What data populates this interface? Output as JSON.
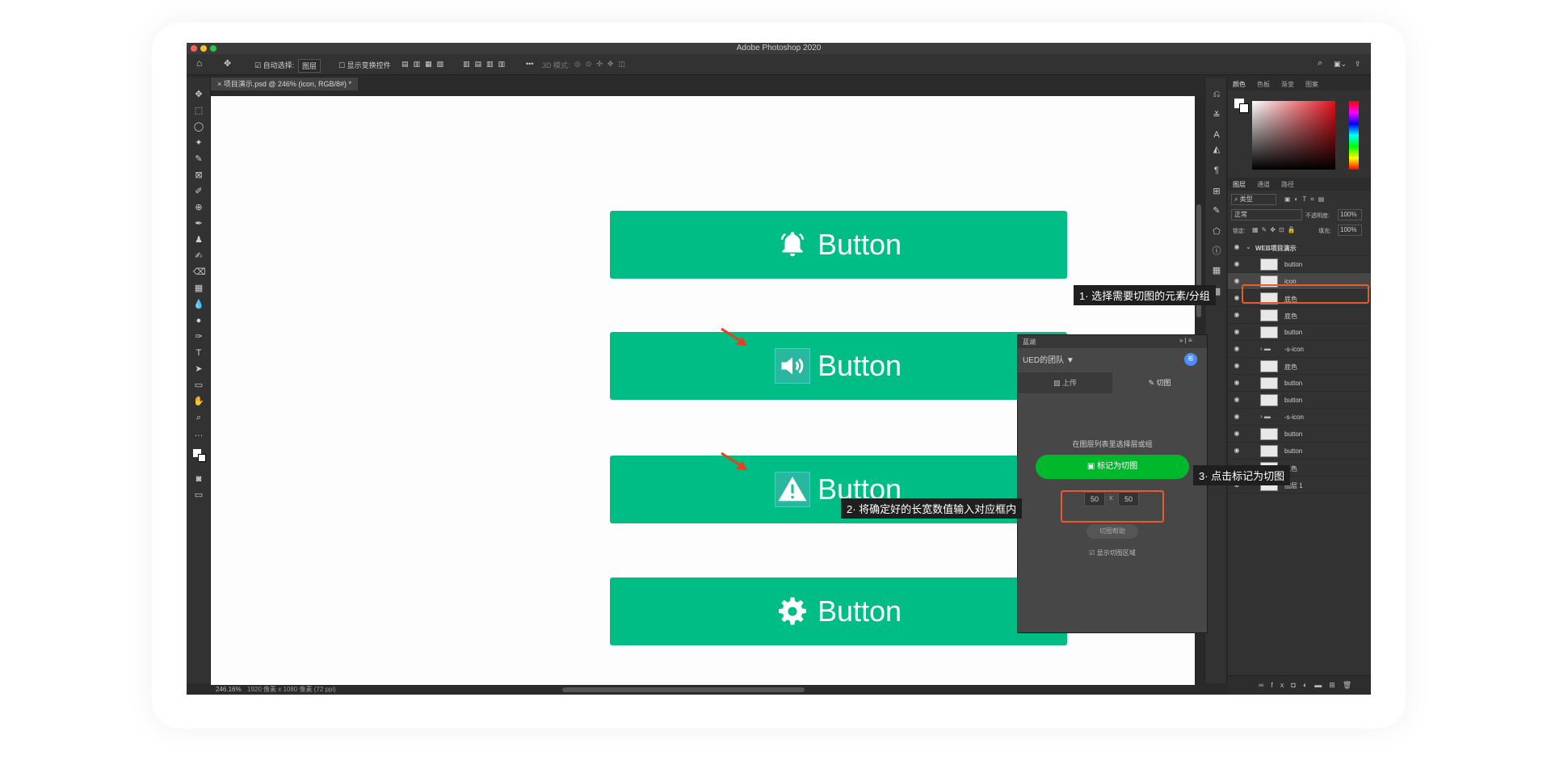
{
  "app": {
    "title": "Adobe Photoshop 2020"
  },
  "options_bar": {
    "auto_select_label": "自动选择:",
    "auto_select_value": "图层",
    "show_transform_label": "显示变换控件",
    "mode_3d_label": "3D 模式:"
  },
  "document": {
    "tab_title": "项目演示.psd @ 246% (icon, RGB/8#) *",
    "zoom": "246.16%",
    "info": "1920 像素 x 1080 像素 (72 ppi)"
  },
  "canvas": {
    "buttons": [
      {
        "label": "Button",
        "icon": "bell-icon"
      },
      {
        "label": "Button",
        "icon": "speaker-icon"
      },
      {
        "label": "Button",
        "icon": "warning-icon"
      },
      {
        "label": "Button",
        "icon": "gear-icon"
      }
    ],
    "accent": "#00bd86"
  },
  "color_panel": {
    "tabs": [
      "颜色",
      "色板",
      "渐变",
      "图案"
    ]
  },
  "layers_panel": {
    "tabs": [
      "图层",
      "通道",
      "路径"
    ],
    "filter_label": "类型",
    "blend_mode": "正常",
    "opacity_label": "不透明度:",
    "opacity_value": "100%",
    "lock_label": "锁定:",
    "fill_label": "填充:",
    "fill_value": "100%",
    "group_name": "WEB项目演示",
    "layers": [
      "button",
      "icon",
      "底色",
      "底色",
      "button",
      "-s-icon",
      "底色",
      "button",
      "button",
      "-s-icon",
      "button",
      "button",
      "底色",
      "图层 1"
    ]
  },
  "plugin": {
    "title": "蓝湖",
    "team": "UED的团队",
    "avatar": "彬",
    "tab_upload": "上传",
    "tab_slice": "切图",
    "hint": "在图层列表里选择层或组",
    "mark_button": "标记为切图",
    "width_value": "50",
    "height_value": "50",
    "times": "x",
    "help_button": "切图帮助",
    "show_area": "显示切图区域"
  },
  "callouts": {
    "step1": "1· 选择需要切图的元素/分组",
    "step2": "2· 将确定好的长宽数值输入对应框内",
    "step3": "3· 点击标记为切图"
  },
  "colors": {
    "highlight": "#e85b2b",
    "mark_green": "#00b82c"
  }
}
